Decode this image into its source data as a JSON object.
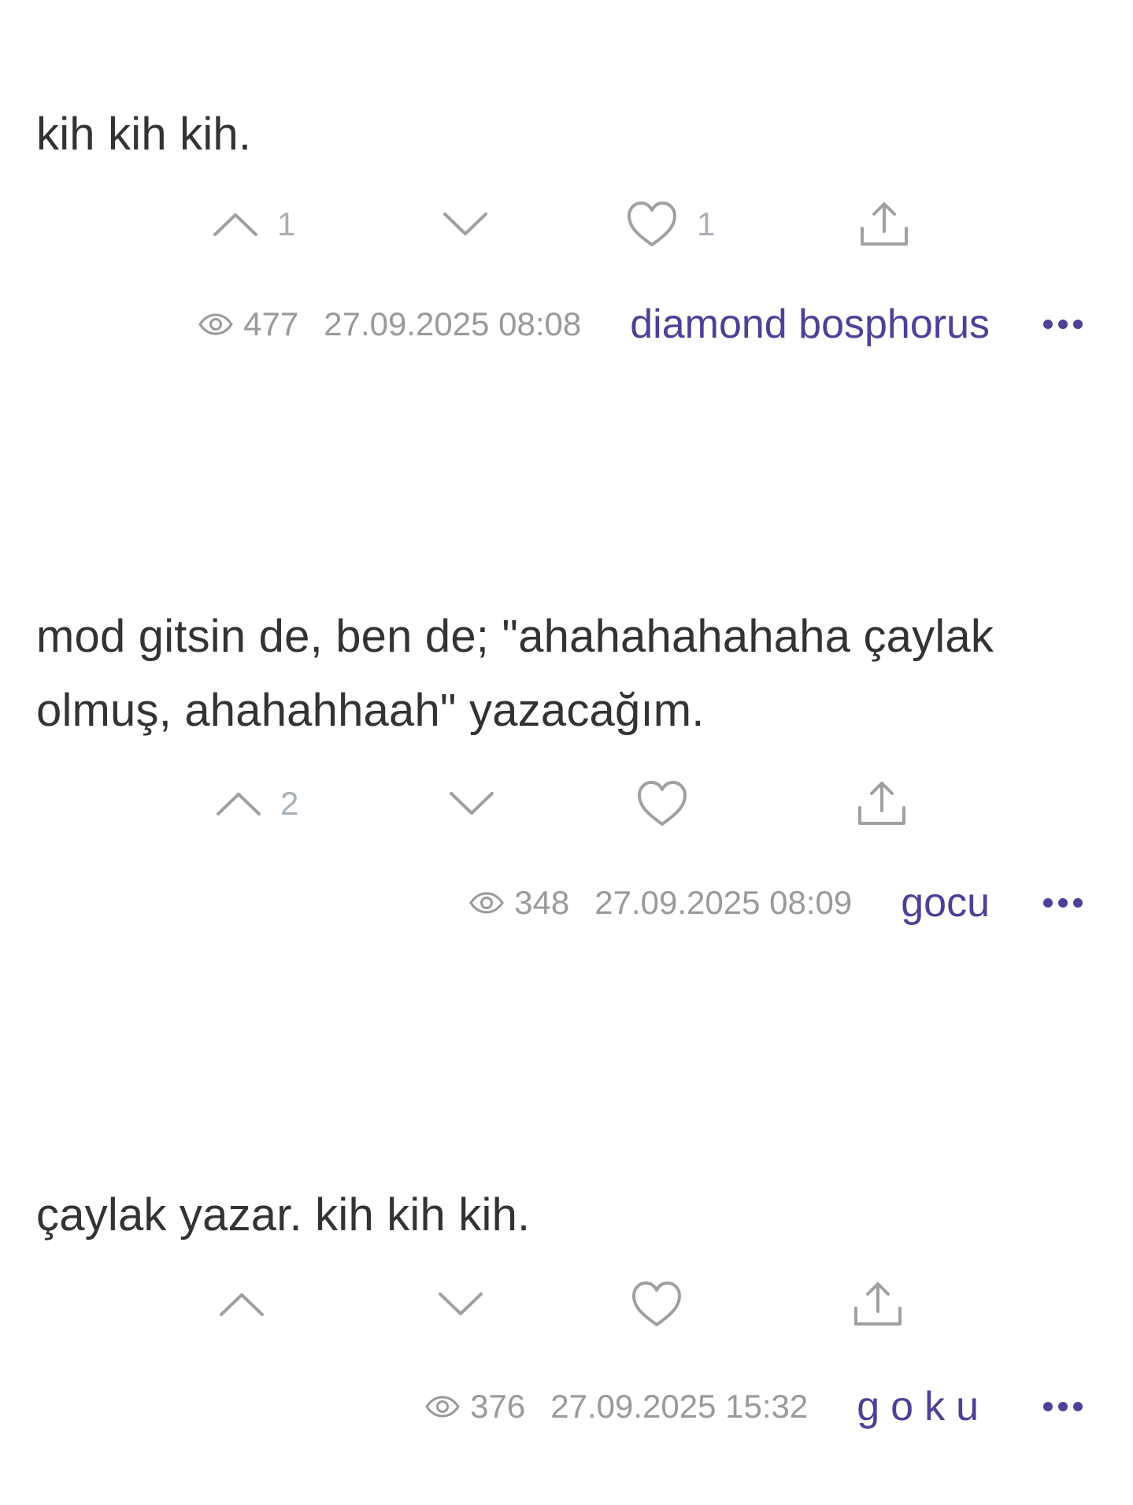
{
  "colors": {
    "text": "#333333",
    "muted": "#9a9a9a",
    "icon": "#a0a0a0",
    "author": "#4f3f96"
  },
  "icons": {
    "upvote": "chevron-up-icon",
    "downvote": "chevron-down-icon",
    "favorite": "heart-icon",
    "share": "share-icon",
    "views": "eye-icon",
    "more": "more-dots-icon"
  },
  "entries": [
    {
      "text": "kih kih kih.",
      "upvotes": "1",
      "favorites": "1",
      "views": "477",
      "date": "27.09.2025 08:08",
      "author": "diamond bosphorus"
    },
    {
      "text": "mod gitsin de, ben de; \"ahahahahahaha çaylak olmuş, ahahahhaah\" yazacağım.",
      "upvotes": "2",
      "favorites": "",
      "views": "348",
      "date": "27.09.2025 08:09",
      "author": "gocu"
    },
    {
      "text": "çaylak yazar. kih kih kih.",
      "upvotes": "",
      "favorites": "",
      "views": "376",
      "date": "27.09.2025 15:32",
      "author": "goku"
    }
  ]
}
